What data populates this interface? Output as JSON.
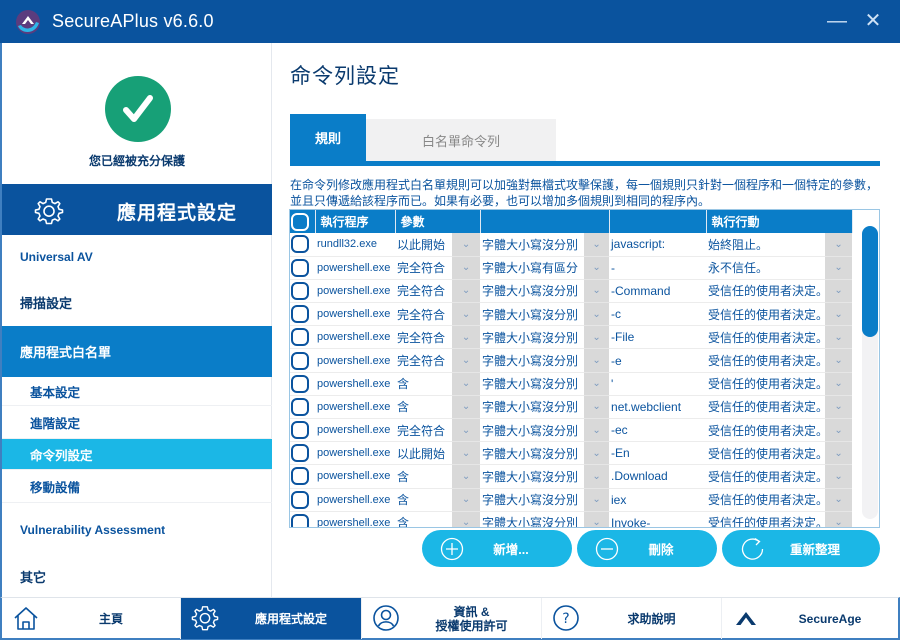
{
  "window": {
    "title": "SecureAPlus v6.6.0",
    "minimize_glyph": "—",
    "close_glyph": "✕"
  },
  "sidebar": {
    "status_text": "您已經被充分保護",
    "section_header": "應用程式設定",
    "items": [
      {
        "label": "Universal AV",
        "state": "normal"
      },
      {
        "label": "掃描設定",
        "state": "normal"
      },
      {
        "label": "應用程式白名單",
        "state": "active-parent"
      },
      {
        "label": "基本設定",
        "state": "sub"
      },
      {
        "label": "進階設定",
        "state": "sub"
      },
      {
        "label": "命令列設定",
        "state": "sub-active"
      },
      {
        "label": "移動設備",
        "state": "sub"
      },
      {
        "label": "Vulnerability Assessment",
        "state": "normal"
      },
      {
        "label": "其它",
        "state": "normal"
      }
    ]
  },
  "main": {
    "page_title": "命令列設定",
    "tabs": [
      {
        "label": "規則",
        "active": true
      },
      {
        "label": "白名單命令列",
        "active": false
      }
    ],
    "description": "在命令列修改應用程式白名單規則可以加強對無檔式攻擊保護，每一個規則只針對一個程序和一個特定的參數，並且只傳遞給該程序而已。如果有必要，也可以增加多個規則到相同的程序內。",
    "table": {
      "columns": [
        "",
        "執行程序",
        "參數",
        "",
        "",
        "",
        "執行行動",
        ""
      ],
      "dropdown_glyph": "⌄",
      "rows": [
        {
          "program": "rundll32.exe",
          "match": "以此開始",
          "case": "字體大小寫沒分別",
          "param": "javascript:",
          "action": "始終阻止。"
        },
        {
          "program": "powershell.exe",
          "match": "完全符合",
          "case": "字體大小寫有區分",
          "param": "-",
          "action": "永不信任。"
        },
        {
          "program": "powershell.exe",
          "match": "完全符合",
          "case": "字體大小寫沒分別",
          "param": "-Command",
          "action": "受信任的使用者決定。"
        },
        {
          "program": "powershell.exe",
          "match": "完全符合",
          "case": "字體大小寫沒分別",
          "param": "-c",
          "action": "受信任的使用者決定。"
        },
        {
          "program": "powershell.exe",
          "match": "完全符合",
          "case": "字體大小寫沒分別",
          "param": "-File",
          "action": "受信任的使用者決定。"
        },
        {
          "program": "powershell.exe",
          "match": "完全符合",
          "case": "字體大小寫沒分別",
          "param": "-e",
          "action": "受信任的使用者決定。"
        },
        {
          "program": "powershell.exe",
          "match": "含",
          "case": "字體大小寫沒分別",
          "param": "'",
          "action": "受信任的使用者決定。"
        },
        {
          "program": "powershell.exe",
          "match": "含",
          "case": "字體大小寫沒分別",
          "param": "net.webclient",
          "action": "受信任的使用者決定。"
        },
        {
          "program": "powershell.exe",
          "match": "完全符合",
          "case": "字體大小寫沒分別",
          "param": "-ec",
          "action": "受信任的使用者決定。"
        },
        {
          "program": "powershell.exe",
          "match": "以此開始",
          "case": "字體大小寫沒分別",
          "param": "-En",
          "action": "受信任的使用者決定。"
        },
        {
          "program": "powershell.exe",
          "match": "含",
          "case": "字體大小寫沒分別",
          "param": ".Download",
          "action": "受信任的使用者決定。"
        },
        {
          "program": "powershell.exe",
          "match": "含",
          "case": "字體大小寫沒分別",
          "param": "iex",
          "action": "受信任的使用者決定。"
        },
        {
          "program": "powershell.exe",
          "match": "含",
          "case": "字體大小寫沒分別",
          "param": "Invoke-",
          "action": "受信任的使用者決定。"
        }
      ]
    },
    "scrollbar": {
      "position_fraction": 0.0,
      "visible_fraction": 0.38
    },
    "actions": {
      "add": "新增...",
      "delete": "刪除",
      "refresh": "重新整理"
    }
  },
  "bottom_nav": [
    {
      "label": "主頁",
      "icon": "home-icon",
      "active": false
    },
    {
      "label": "應用程式設定",
      "icon": "gear-icon",
      "active": true
    },
    {
      "label": "資訊 &\n授權使用許可",
      "icon": "user-icon",
      "active": false
    },
    {
      "label": "求助說明",
      "icon": "help-icon",
      "active": false
    },
    {
      "label": "SecureAge",
      "icon": "secureage-logo-icon",
      "active": false
    }
  ],
  "colors": {
    "brand_dark": "#0a539e",
    "brand_blue": "#0a7dc8",
    "accent_cyan": "#1bb7e6",
    "status_green": "#17a077"
  }
}
